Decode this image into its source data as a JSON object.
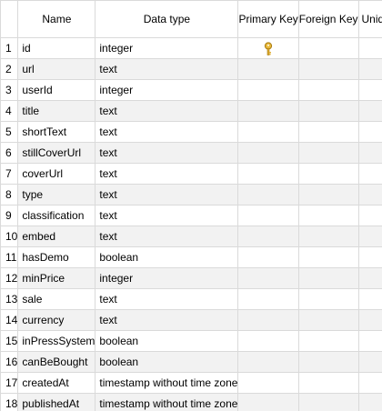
{
  "columns_header": {
    "name": "Name",
    "data_type": "Data type",
    "primary_key": "Primary Key",
    "foreign_key": "Foreign Key",
    "unique": "Uniqu"
  },
  "rows": [
    {
      "n": "1",
      "name": "id",
      "type": "integer",
      "pk": true
    },
    {
      "n": "2",
      "name": "url",
      "type": "text"
    },
    {
      "n": "3",
      "name": "userId",
      "type": "integer"
    },
    {
      "n": "4",
      "name": "title",
      "type": "text"
    },
    {
      "n": "5",
      "name": "shortText",
      "type": "text"
    },
    {
      "n": "6",
      "name": "stillCoverUrl",
      "type": "text"
    },
    {
      "n": "7",
      "name": "coverUrl",
      "type": "text"
    },
    {
      "n": "8",
      "name": "type",
      "type": "text"
    },
    {
      "n": "9",
      "name": "classification",
      "type": "text"
    },
    {
      "n": "10",
      "name": "embed",
      "type": "text"
    },
    {
      "n": "11",
      "name": "hasDemo",
      "type": "boolean"
    },
    {
      "n": "12",
      "name": "minPrice",
      "type": "integer"
    },
    {
      "n": "13",
      "name": "sale",
      "type": "text"
    },
    {
      "n": "14",
      "name": "currency",
      "type": "text"
    },
    {
      "n": "15",
      "name": "inPressSystem",
      "type": "boolean"
    },
    {
      "n": "16",
      "name": "canBeBought",
      "type": "boolean"
    },
    {
      "n": "17",
      "name": "createdAt",
      "type": "timestamp without time zone"
    },
    {
      "n": "18",
      "name": "publishedAt",
      "type": "timestamp without time zone"
    }
  ],
  "icons": {
    "primary_key": "key-icon"
  },
  "colors": {
    "grid_line": "#dadada",
    "alt_row": "#f2f2f2",
    "key_gold": "#d9a52a"
  }
}
